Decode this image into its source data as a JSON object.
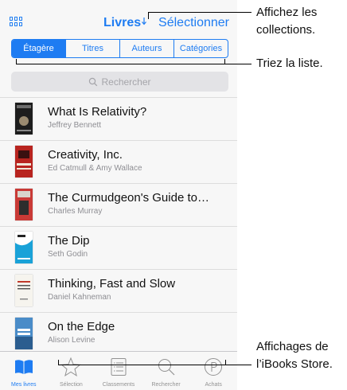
{
  "navbar": {
    "title": "Livres",
    "select_label": "Sélectionner"
  },
  "segments": [
    "Étagère",
    "Titres",
    "Auteurs",
    "Catégories"
  ],
  "search": {
    "placeholder": "Rechercher"
  },
  "books": [
    {
      "title": "What Is Relativity?",
      "author": "Jeffrey Bennett"
    },
    {
      "title": "Creativity, Inc.",
      "author": "Ed Catmull & Amy Wallace"
    },
    {
      "title": "The Curmudgeon's Guide to…",
      "author": "Charles Murray"
    },
    {
      "title": "The Dip",
      "author": "Seth Godin"
    },
    {
      "title": "Thinking, Fast and Slow",
      "author": "Daniel Kahneman"
    },
    {
      "title": "On the Edge",
      "author": "Alison Levine"
    }
  ],
  "tabs": [
    "Mes livres",
    "Sélection",
    "Classements",
    "Rechercher",
    "Achats"
  ],
  "callouts": {
    "collections": [
      "Affichez les",
      "collections."
    ],
    "sort": "Triez la liste.",
    "store": [
      "Affichages de",
      "l’iBooks Store."
    ]
  },
  "colors": {
    "accent": "#1e7cf2",
    "inactive": "#929292"
  }
}
